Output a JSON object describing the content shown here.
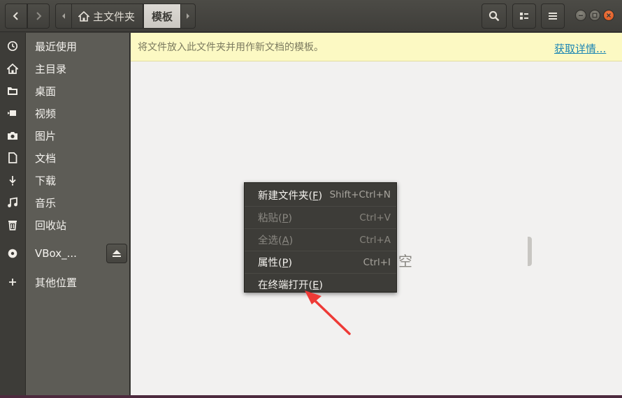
{
  "header": {
    "breadcrumb_home": "主文件夹",
    "breadcrumb_current": "模板"
  },
  "sidebar": {
    "items": [
      {
        "label": "最近使用",
        "icon": "recent-icon"
      },
      {
        "label": "主目录",
        "icon": "home-icon"
      },
      {
        "label": "桌面",
        "icon": "desktop-folder-icon"
      },
      {
        "label": "视频",
        "icon": "video-icon"
      },
      {
        "label": "图片",
        "icon": "camera-icon"
      },
      {
        "label": "文档",
        "icon": "document-icon"
      },
      {
        "label": "下载",
        "icon": "download-icon"
      },
      {
        "label": "音乐",
        "icon": "music-icon"
      },
      {
        "label": "回收站",
        "icon": "trash-icon"
      },
      {
        "label": "VBox_...",
        "icon": "disc-icon"
      },
      {
        "label": "其他位置",
        "icon": "plus-icon"
      }
    ]
  },
  "infobar": {
    "text": "将文件放入此文件夹并用作新文档的模板。",
    "link": "获取详情..."
  },
  "main": {
    "empty_label": "空"
  },
  "context_menu": {
    "items": [
      {
        "label": "新建文件夹(F)",
        "mnemonic": "F",
        "shortcut": "Shift+Ctrl+N",
        "enabled": true
      },
      {
        "label": "粘贴(P)",
        "mnemonic": "P",
        "shortcut": "Ctrl+V",
        "enabled": false
      },
      {
        "label": "全选(A)",
        "mnemonic": "A",
        "shortcut": "Ctrl+A",
        "enabled": false
      },
      {
        "label": "属性(P)",
        "mnemonic": "P",
        "shortcut": "Ctrl+I",
        "enabled": true
      },
      {
        "label": "在终端打开(E)",
        "mnemonic": "E",
        "shortcut": "",
        "enabled": true
      }
    ]
  },
  "colors": {
    "accent_close": "#e95420",
    "infobar_bg": "#fcf9c3",
    "link": "#1e87b4",
    "annotation_arrow": "#ee3a36"
  }
}
